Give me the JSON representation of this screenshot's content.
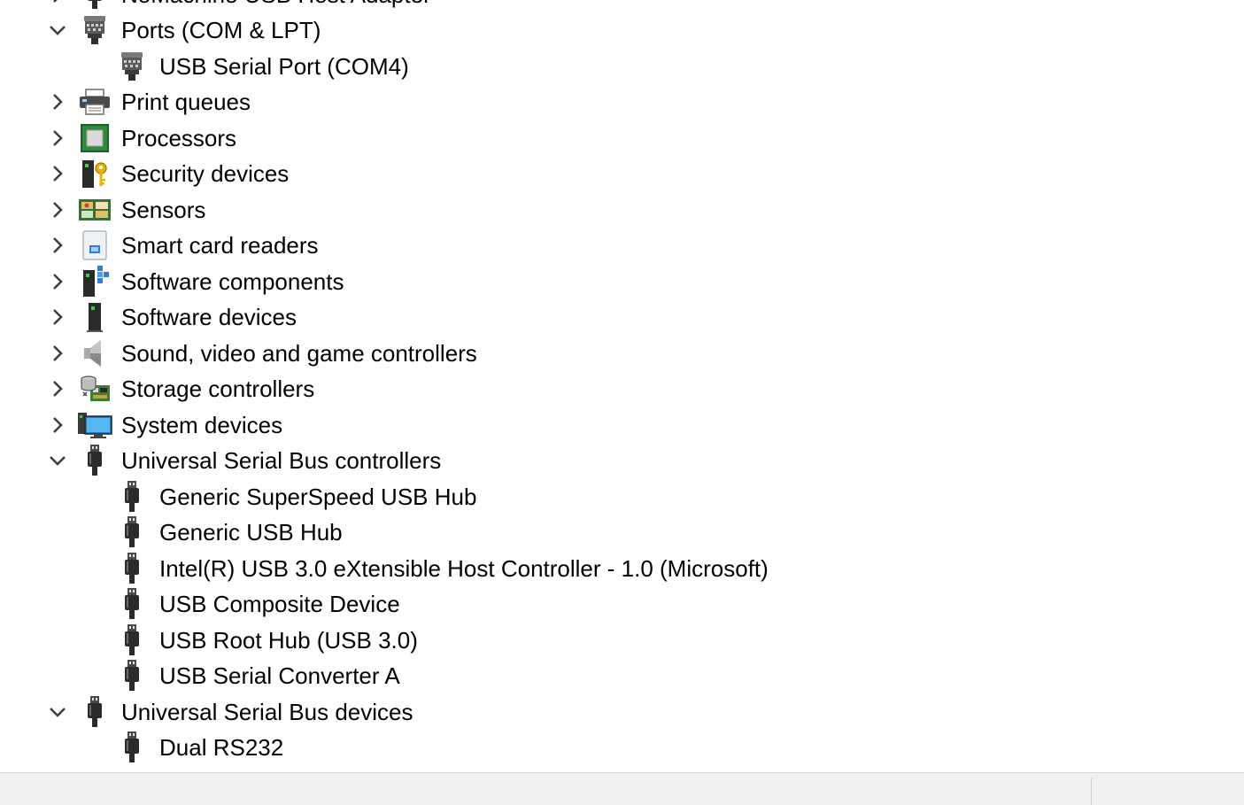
{
  "tree": {
    "top_partial_label": "NoMachine USB Host Adapter",
    "items": [
      {
        "kind": "category",
        "expanded": true,
        "label": "Ports (COM & LPT)",
        "icon": "port-icon"
      },
      {
        "kind": "device",
        "label": "USB Serial Port (COM4)",
        "icon": "port-icon"
      },
      {
        "kind": "category",
        "expanded": false,
        "label": "Print queues",
        "icon": "printer-icon"
      },
      {
        "kind": "category",
        "expanded": false,
        "label": "Processors",
        "icon": "processor-icon"
      },
      {
        "kind": "category",
        "expanded": false,
        "label": "Security devices",
        "icon": "security-key-icon"
      },
      {
        "kind": "category",
        "expanded": false,
        "label": "Sensors",
        "icon": "sensor-icon"
      },
      {
        "kind": "category",
        "expanded": false,
        "label": "Smart card readers",
        "icon": "smart-card-icon"
      },
      {
        "kind": "category",
        "expanded": false,
        "label": "Software components",
        "icon": "software-component-icon"
      },
      {
        "kind": "category",
        "expanded": false,
        "label": "Software devices",
        "icon": "software-device-icon"
      },
      {
        "kind": "category",
        "expanded": false,
        "label": "Sound, video and game controllers",
        "icon": "speaker-icon"
      },
      {
        "kind": "category",
        "expanded": false,
        "label": "Storage controllers",
        "icon": "storage-icon"
      },
      {
        "kind": "category",
        "expanded": false,
        "label": "System devices",
        "icon": "monitor-icon"
      },
      {
        "kind": "category",
        "expanded": true,
        "label": "Universal Serial Bus controllers",
        "icon": "usb-icon"
      },
      {
        "kind": "device",
        "label": "Generic SuperSpeed USB Hub",
        "icon": "usb-icon"
      },
      {
        "kind": "device",
        "label": "Generic USB Hub",
        "icon": "usb-icon"
      },
      {
        "kind": "device",
        "label": "Intel(R) USB 3.0 eXtensible Host Controller - 1.0 (Microsoft)",
        "icon": "usb-icon"
      },
      {
        "kind": "device",
        "label": "USB Composite Device",
        "icon": "usb-icon"
      },
      {
        "kind": "device",
        "label": "USB Root Hub (USB 3.0)",
        "icon": "usb-icon"
      },
      {
        "kind": "device",
        "label": "USB Serial Converter A",
        "icon": "usb-icon"
      },
      {
        "kind": "category",
        "expanded": true,
        "label": "Universal Serial Bus devices",
        "icon": "usb-icon"
      },
      {
        "kind": "device",
        "label": "Dual RS232",
        "icon": "usb-icon"
      }
    ]
  },
  "colors": {
    "chevron": "#404040",
    "statusbar_bg": "#f0f0f0"
  }
}
